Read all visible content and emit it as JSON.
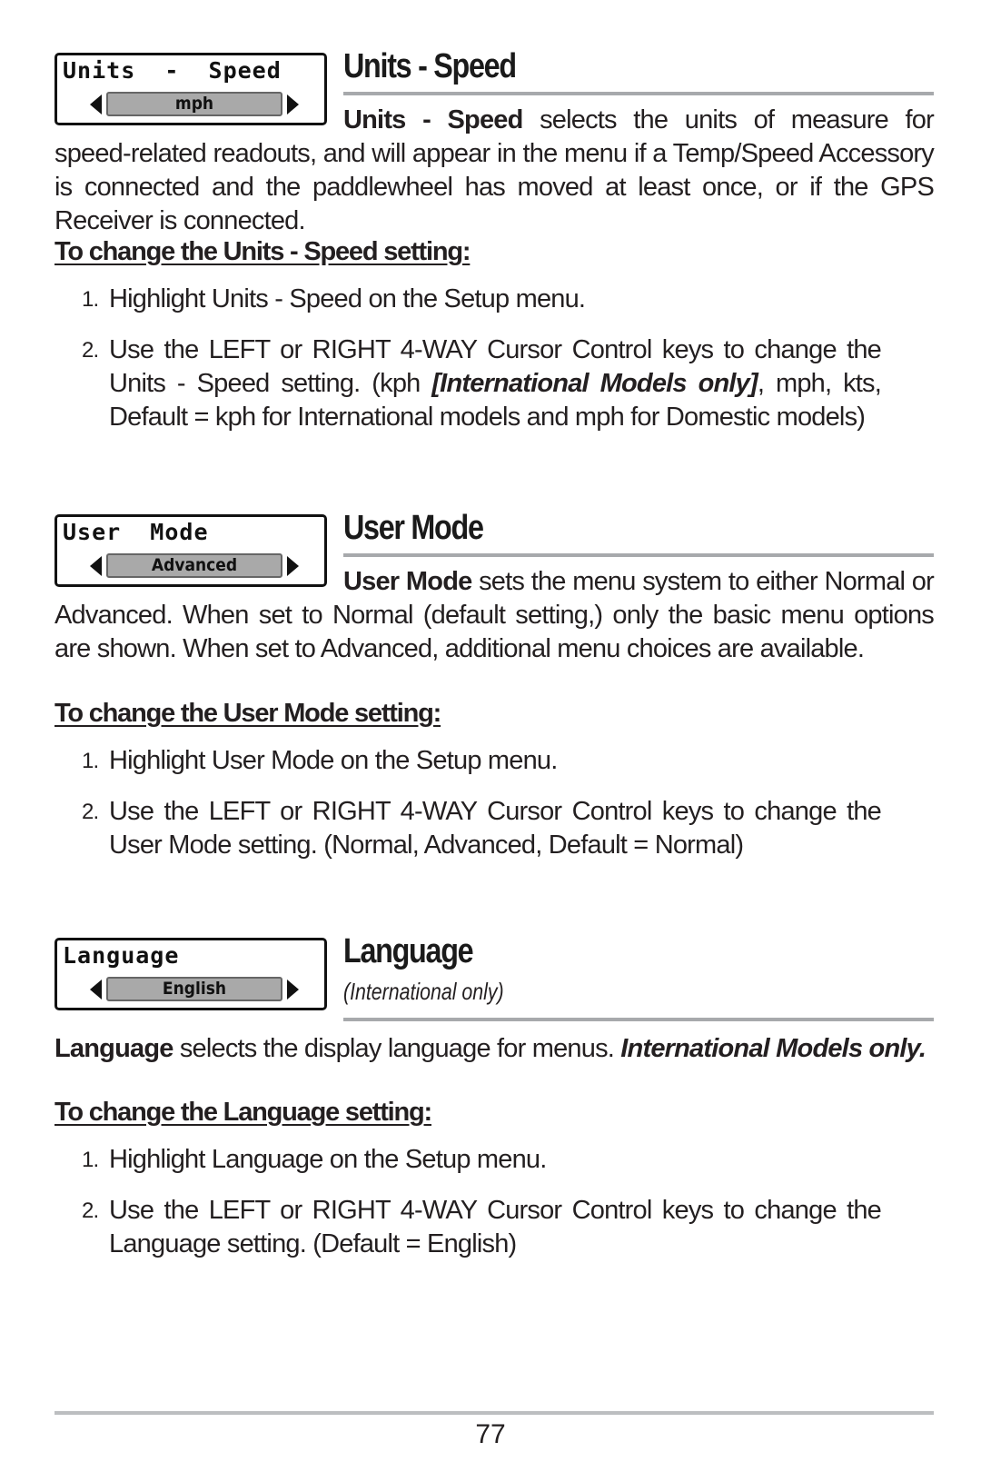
{
  "sections": [
    {
      "widget": {
        "title": "Units  -  Speed",
        "value": "mph"
      },
      "heading": "Units - Speed",
      "subheading": "",
      "description": {
        "bold_lead": "Units - Speed",
        "text": " selects the units of measure for speed-related readouts, and will appear in the menu if a Temp/Speed Accessory is connected and the paddlewheel has moved at least once, or if the GPS Receiver is connected."
      },
      "howto": "To change the Units - Speed setting:",
      "steps": [
        {
          "num": "1.",
          "text": "Highlight Units - Speed on the Setup menu."
        },
        {
          "num": "2.",
          "text_before": "Use the LEFT or RIGHT 4-WAY Cursor Control keys to change the Units - Speed setting. (kph ",
          "italic": "[International Models only]",
          "text_after": ", mph, kts, Default = kph for International models and mph for Domestic models)"
        }
      ]
    },
    {
      "widget": {
        "title": "User  Mode",
        "value": "Advanced"
      },
      "heading": "User Mode",
      "subheading": "",
      "description": {
        "bold_lead": "User Mode",
        "text": " sets the menu system to either Normal or Advanced. When set to Normal (default setting,) only the basic menu options are shown.  When set to Advanced, additional menu choices are available."
      },
      "howto": "To change the User Mode setting:",
      "steps": [
        {
          "num": "1.",
          "text": "Highlight User Mode on the Setup menu."
        },
        {
          "num": "2.",
          "text": "Use the LEFT or RIGHT 4-WAY Cursor Control keys to change the User Mode setting. (Normal, Advanced, Default = Normal)"
        }
      ]
    },
    {
      "widget": {
        "title": "Language",
        "value": "English"
      },
      "heading": "Language",
      "subheading": "(International only)",
      "description": {
        "bold_lead": "Language",
        "text": " selects the display language for menus. ",
        "italic_tail": "International Models only."
      },
      "howto": "To change the Language setting:",
      "steps": [
        {
          "num": "1.",
          "text": "Highlight Language on the Setup menu."
        },
        {
          "num": "2.",
          "text": "Use the LEFT or RIGHT 4-WAY Cursor Control keys to change the Language setting. (Default = English)"
        }
      ]
    }
  ],
  "footer": {
    "page_number": "77"
  }
}
